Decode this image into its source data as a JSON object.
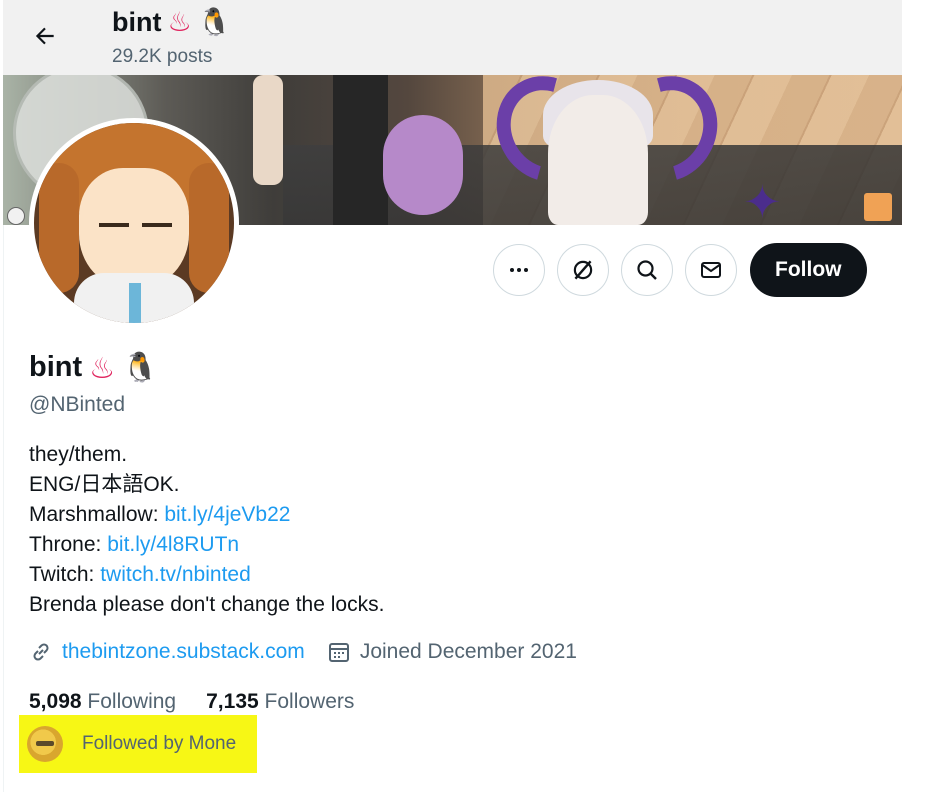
{
  "header": {
    "name": "bint",
    "posts": "29.2K posts"
  },
  "profile": {
    "name": "bint",
    "handle": "@NBinted",
    "emoji_hotspring": "♨",
    "emoji_penguin": "🐧",
    "bio": {
      "line1": "they/them.",
      "line2": "ENG/日本語OK.",
      "marshmallow_label": "Marshmallow: ",
      "marshmallow_link": "bit.ly/4jeVb22",
      "throne_label": "Throne: ",
      "throne_link": "bit.ly/4l8RUTn",
      "twitch_label": "Twitch: ",
      "twitch_link": "twitch.tv/nbinted",
      "line6": "Brenda please don't change the locks."
    },
    "website": "thebintzone.substack.com",
    "joined": "Joined December 2021",
    "following_count": "5,098",
    "following_label": "Following",
    "followers_count": "7,135",
    "followers_label": "Followers",
    "followed_by": "Followed by Mone"
  },
  "actions": {
    "follow_label": "Follow",
    "more_icon": "more-icon",
    "grok_icon": "grok-icon",
    "search_icon": "search-icon",
    "message_icon": "message-icon"
  },
  "colors": {
    "accent": "#1d9bf0",
    "follow_bg": "#0f1419",
    "highlight": "#f7f715",
    "secondary_text": "#536471"
  }
}
